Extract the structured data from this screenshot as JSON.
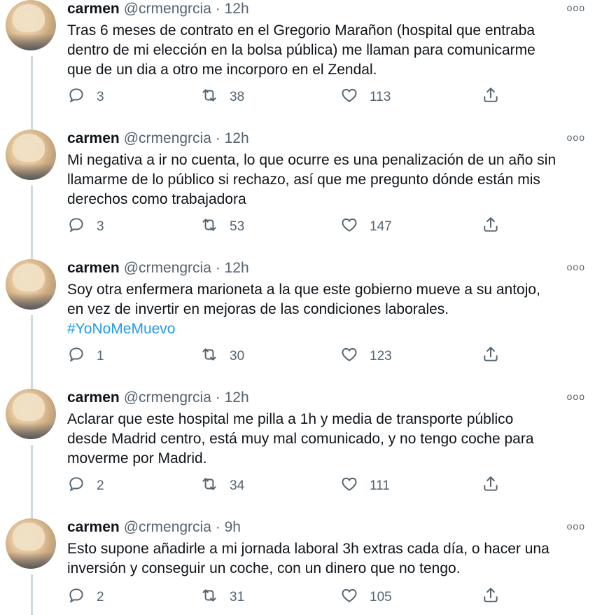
{
  "tweets": [
    {
      "name": "carmen",
      "handle": "@crmengrcia",
      "time": "12h",
      "lines": [
        "Tras 6 meses de contrato en el Gregorio Marañon (hospital que entraba",
        "dentro de mi elección en la bolsa pública) me llaman para comunicarme",
        "que de un dia a otro me incorporo en el Zendal."
      ],
      "hashtag": "",
      "replies": "3",
      "retweets": "38",
      "likes": "113"
    },
    {
      "name": "carmen",
      "handle": "@crmengrcia",
      "time": "12h",
      "lines": [
        "Mi negativa a ir no cuenta, lo que ocurre es una penalización de un año sin",
        "llamarme de lo público si rechazo, así que me pregunto dónde están mis",
        "derechos como trabajadora"
      ],
      "hashtag": "",
      "replies": "3",
      "retweets": "53",
      "likes": "147"
    },
    {
      "name": "carmen",
      "handle": "@crmengrcia",
      "time": "12h",
      "lines": [
        "Soy otra enfermera marioneta a la que este gobierno mueve a su antojo,",
        "en vez de invertir en mejoras de las condiciones laborales."
      ],
      "hashtag": "#YoNoMeMuevo",
      "replies": "1",
      "retweets": "30",
      "likes": "123"
    },
    {
      "name": "carmen",
      "handle": "@crmengrcia",
      "time": "12h",
      "lines": [
        "Aclarar que este hospital me pilla a 1h y media de transporte público",
        "desde Madrid centro, está muy mal comunicado, y no tengo coche para",
        "moverme por Madrid."
      ],
      "hashtag": "",
      "replies": "2",
      "retweets": "34",
      "likes": "111"
    },
    {
      "name": "carmen",
      "handle": "@crmengrcia",
      "time": "9h",
      "lines": [
        "Esto supone añadirle a mi jornada laboral 3h extras cada día, o hacer una",
        "inversión y conseguir un coche, con un dinero que no tengo."
      ],
      "hashtag": "",
      "replies": "2",
      "retweets": "31",
      "likes": "105"
    }
  ],
  "time_separator": "·",
  "more_icon": "more-dots-icon",
  "colors": {
    "text": "#0f1419",
    "muted": "#536471",
    "link": "#1d9bf0",
    "thread_line": "#cfd9de"
  }
}
